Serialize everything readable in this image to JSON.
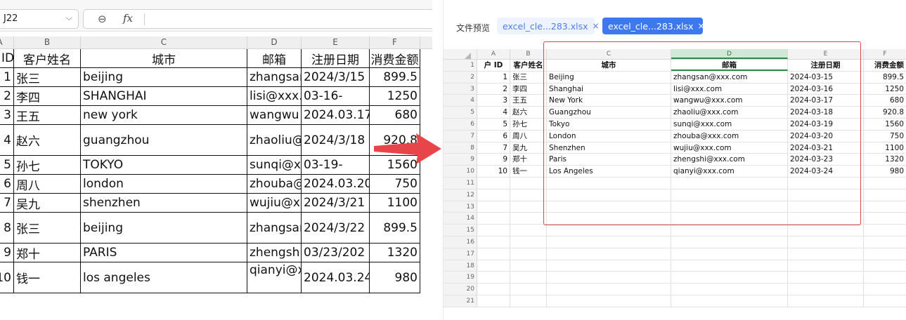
{
  "left": {
    "name_box": "J22",
    "column_headers": [
      "A",
      "B",
      "C",
      "D",
      "E",
      "F"
    ],
    "header_row": [
      "ID",
      "客户姓名",
      "城市",
      "邮箱",
      "注册日期",
      "消费金额"
    ],
    "rows": [
      [
        "1",
        "张三",
        "beijing",
        "zhangsan",
        "2024/3/15",
        "899.5"
      ],
      [
        "2",
        "李四",
        "SHANGHAI",
        "lisi@xxx.c",
        "03-16-",
        "1250"
      ],
      [
        "3",
        "王五",
        "new york",
        "wangwu",
        "2024.03.17",
        "680"
      ],
      [
        "4",
        "赵六",
        "guangzhou",
        "zhaoliu@",
        "2024/3/18",
        "920.8"
      ],
      [
        "5",
        "孙七",
        "TOKYO",
        "sunqi@xx",
        "03-19-",
        "1560"
      ],
      [
        "6",
        "周八",
        "london",
        "zhouba@",
        "2024.03.20",
        "750"
      ],
      [
        "7",
        "吴九",
        "shenzhen",
        "wujiu@xx",
        "2024/3/21",
        "1100"
      ],
      [
        "8",
        "张三",
        "beijing",
        "zhangsan",
        "2024/3/22",
        "899.5"
      ],
      [
        "9",
        "郑十",
        "PARIS",
        "zhengshi",
        "03/23/202",
        "1320"
      ],
      [
        "10",
        "钱一",
        "los angeles",
        "qianyi@xx.com",
        "2024.03.24",
        "980"
      ]
    ]
  },
  "right": {
    "preview_label": "文件预览",
    "tabs": [
      {
        "label": "excel_cle...283.xlsx",
        "close": "×"
      },
      {
        "label": "excel_cle...283.xlsx",
        "close": "×"
      }
    ],
    "column_headers": [
      "A",
      "B",
      "C",
      "D",
      "E",
      "F"
    ],
    "row_numbers": [
      "1",
      "2",
      "3",
      "4",
      "5",
      "6",
      "7",
      "8",
      "9",
      "10",
      "11",
      "12",
      "13",
      "14",
      "15",
      "16",
      "17",
      "18",
      "19",
      "20",
      "21"
    ],
    "header_row": [
      "户 ID",
      "客户姓名",
      "城市",
      "邮箱",
      "注册日期",
      "消费金额"
    ],
    "rows": [
      [
        "1",
        "张三",
        "Beijing",
        "zhangsan@xxx.com",
        "2024-03-15",
        "899.5"
      ],
      [
        "2",
        "李四",
        "Shanghai",
        "lisi@xxx.com",
        "2024-03-16",
        "1250"
      ],
      [
        "3",
        "王五",
        "New York",
        "wangwu@xxx.com",
        "2024-03-17",
        "680"
      ],
      [
        "4",
        "赵六",
        "Guangzhou",
        "zhaoliu@xxx.com",
        "2024-03-18",
        "920.8"
      ],
      [
        "5",
        "孙七",
        "Tokyo",
        "sunqi@xxx.com",
        "2024-03-19",
        "1560"
      ],
      [
        "6",
        "周八",
        "London",
        "zhouba@xxx.com",
        "2024-03-20",
        "750"
      ],
      [
        "7",
        "吴九",
        "Shenzhen",
        "wujiu@xxx.com",
        "2024-03-21",
        "1100"
      ],
      [
        "9",
        "郑十",
        "Paris",
        "zhengshi@xxx.com",
        "2024-03-23",
        "1320"
      ],
      [
        "10",
        "钱一",
        "Los Angeles",
        "qianyi@xxx.com",
        "2024-03-24",
        "980"
      ]
    ]
  },
  "colors": {
    "arrow": "#e8454a",
    "highlight_box": "#e04848",
    "selected_column": "#2e8a4c",
    "active_tab": "#3e78f0"
  }
}
